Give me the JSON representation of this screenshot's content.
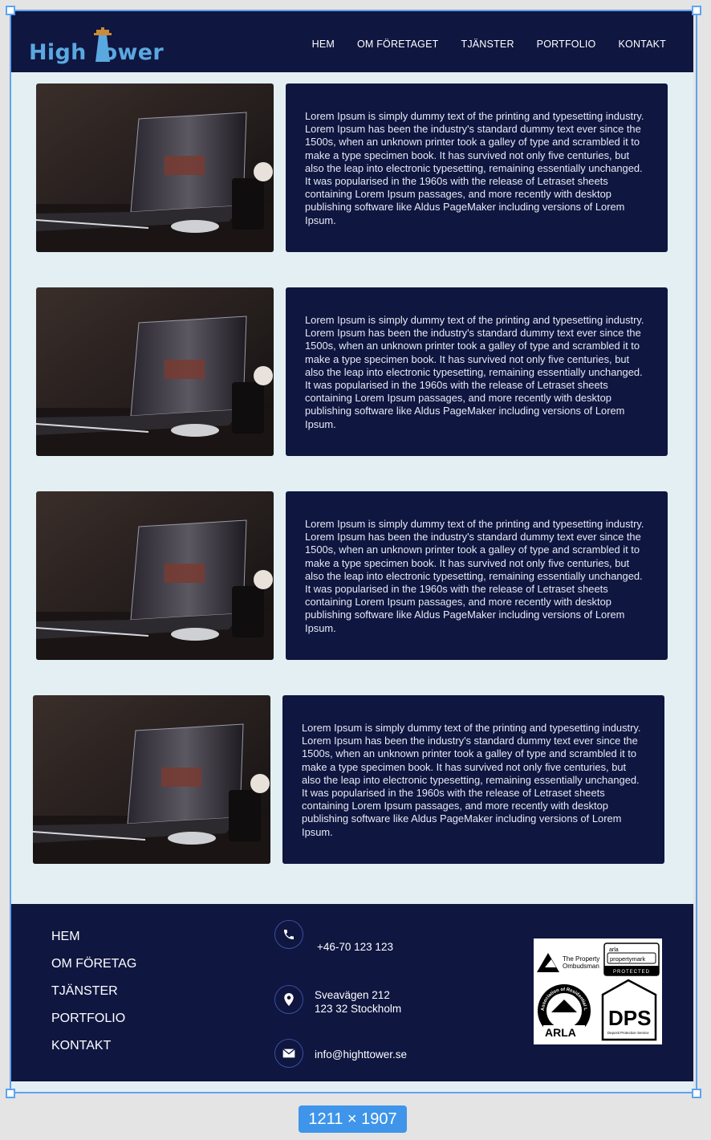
{
  "header": {
    "logo_text_left": "High",
    "logo_text_right": "ower",
    "nav": [
      "HEM",
      "OM FÖRETAGET",
      "TJÄNSTER",
      "PORTFOLIO",
      "KONTAKT"
    ]
  },
  "cards": [
    {
      "text": "Lorem Ipsum is simply dummy text of the printing and typesetting industry. Lorem Ipsum has been the industry's standard dummy text ever since the 1500s, when an unknown printer took a galley of type and scrambled it to make a type specimen book. It has survived not only five centuries, but also the leap into electronic typesetting, remaining essentially unchanged. It was popularised in the 1960s with the release of Letraset sheets containing Lorem Ipsum passages, and more recently with desktop publishing software like Aldus PageMaker including versions of Lorem Ipsum."
    },
    {
      "text": "Lorem Ipsum is simply dummy text of the printing and typesetting industry. Lorem Ipsum has been the industry's standard dummy text ever since the 1500s, when an unknown printer took a galley of type and scrambled it to make a type specimen book. It has survived not only five centuries, but also the leap into electronic typesetting, remaining essentially unchanged. It was popularised in the 1960s with the release of Letraset sheets containing Lorem Ipsum passages, and more recently with desktop publishing software like Aldus PageMaker including versions of Lorem Ipsum."
    },
    {
      "text": "Lorem Ipsum is simply dummy text of the printing and typesetting industry. Lorem Ipsum has been the industry's standard dummy text ever since the 1500s, when an unknown printer took a galley of type and scrambled it to make a type specimen book. It has survived not only five centuries, but also the leap into electronic typesetting, remaining essentially unchanged. It was popularised in the 1960s with the release of Letraset sheets containing Lorem Ipsum passages, and more recently with desktop publishing software like Aldus PageMaker including versions of Lorem Ipsum."
    },
    {
      "text": "Lorem Ipsum is simply dummy text of the printing and typesetting industry. Lorem Ipsum has been the industry's standard dummy text ever since the 1500s, when an unknown printer took a galley of type and scrambled it to make a type specimen book. It has survived not only five centuries, but also the leap into electronic typesetting, remaining essentially unchanged. It was popularised in the 1960s with the release of Letraset sheets containing Lorem Ipsum passages, and more recently with desktop publishing software like Aldus PageMaker including versions of Lorem Ipsum."
    }
  ],
  "footer": {
    "nav": [
      "HEM",
      "OM FÖRETAG",
      "TJÄNSTER",
      "PORTFOLIO",
      "KONTAKT"
    ],
    "phone": "+46-70 123 123",
    "address_line1": "Sveavägen 212",
    "address_line2": "123 32 Stockholm",
    "email": "info@highttower.se",
    "badges": {
      "ombudsman_line1": "The Property",
      "ombudsman_line2": "Ombudsman",
      "arla_small": "arla",
      "arla_big": "propertymark",
      "arla_protected": "PROTECTED",
      "assoc_ring": "Association of Residential Letting Agents",
      "arla_word": "ARLA",
      "dps": "DPS",
      "dps_sub": "Deposit Protection Service"
    }
  },
  "canvas_size_label": "1211 × 1907",
  "colors": {
    "navy": "#0f1640",
    "page_bg": "#e3eff2",
    "logo_blue": "#5aa8e0",
    "selection_blue": "#5fa3ef"
  },
  "icons": [
    "lighthouse-icon",
    "phone-icon",
    "location-pin-icon",
    "mail-icon"
  ]
}
